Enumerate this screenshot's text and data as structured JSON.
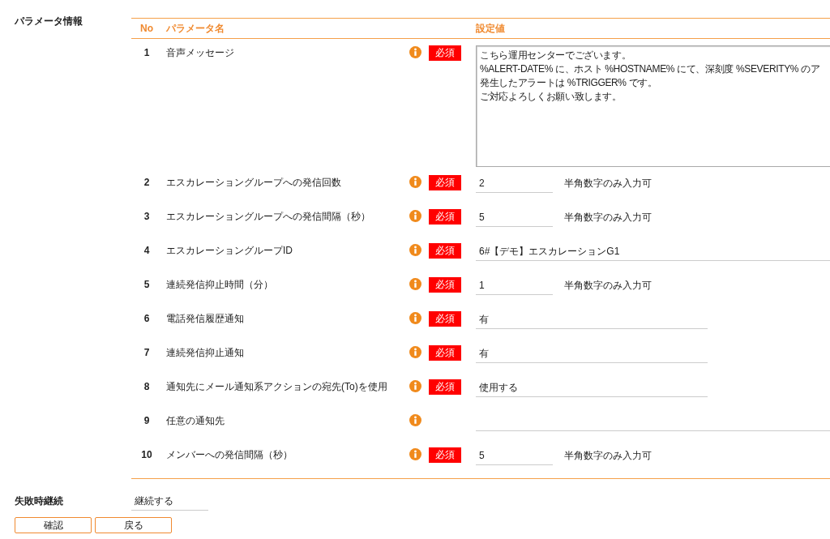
{
  "section_label": "パラメータ情報",
  "table": {
    "columns": [
      "No",
      "パラメータ名",
      "設定値"
    ],
    "rows": [
      {
        "no": "1",
        "name": "音声メッセージ",
        "required_badge": "必須",
        "kind": "textarea",
        "value_lines": [
          "こちら運用センターでございます。",
          "%ALERT-DATE% に、ホスト %HOSTNAME% にて、深刻度 %SEVERITY% のア",
          "発生したアラートは %TRIGGER% です。",
          "ご対応よろしくお願い致します。"
        ]
      },
      {
        "no": "2",
        "name": "エスカレーショングループへの発信回数",
        "required_badge": "必須",
        "kind": "short",
        "value": "2",
        "hint": "半角数字のみ入力可"
      },
      {
        "no": "3",
        "name": "エスカレーショングループへの発信間隔（秒）",
        "required_badge": "必須",
        "kind": "short",
        "value": "5",
        "hint": "半角数字のみ入力可"
      },
      {
        "no": "4",
        "name": "エスカレーショングループID",
        "required_badge": "必須",
        "kind": "long",
        "value": "6#【デモ】エスカレーションG1"
      },
      {
        "no": "5",
        "name": "連続発信抑止時間（分）",
        "required_badge": "必須",
        "kind": "short",
        "value": "1",
        "hint": "半角数字のみ入力可"
      },
      {
        "no": "6",
        "name": "電話発信履歴通知",
        "required_badge": "必須",
        "kind": "medium",
        "value": "有"
      },
      {
        "no": "7",
        "name": "連続発信抑止通知",
        "required_badge": "必須",
        "kind": "medium",
        "value": "有"
      },
      {
        "no": "8",
        "name": "通知先にメール通知系アクションの宛先(To)を使用",
        "required_badge": "必須",
        "kind": "medium",
        "value": "使用する"
      },
      {
        "no": "9",
        "name": "任意の通知先",
        "kind": "long"
      },
      {
        "no": "10",
        "name": "メンバーへの発信間隔（秒）",
        "required_badge": "必須",
        "kind": "short",
        "value": "5",
        "hint": "半角数字のみ入力可"
      }
    ]
  },
  "failure": {
    "label": "失敗時継続",
    "value": "継続する"
  },
  "buttons": [
    "確認",
    "戻る"
  ]
}
